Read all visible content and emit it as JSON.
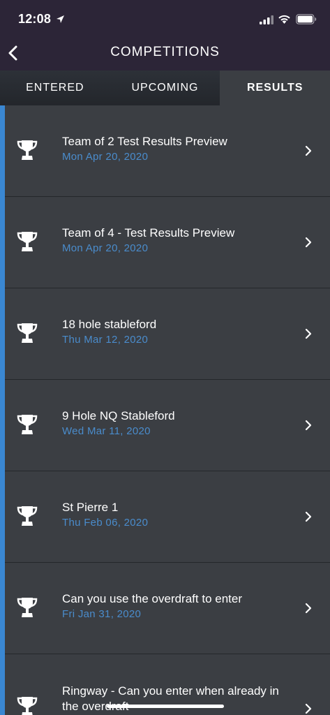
{
  "status_bar": {
    "time": "12:08"
  },
  "nav": {
    "title": "COMPETITIONS"
  },
  "tabs": [
    {
      "label": "ENTERED",
      "active": false
    },
    {
      "label": "UPCOMING",
      "active": false
    },
    {
      "label": "RESULTS",
      "active": true
    }
  ],
  "results": [
    {
      "title": "Team of 2 Test Results Preview",
      "date": "Mon Apr 20, 2020"
    },
    {
      "title": "Team of 4 - Test Results Preview",
      "date": "Mon Apr 20, 2020"
    },
    {
      "title": "18 hole stableford",
      "date": "Thu Mar 12, 2020"
    },
    {
      "title": "9 Hole NQ Stableford",
      "date": "Wed Mar 11, 2020"
    },
    {
      "title": "St Pierre 1",
      "date": "Thu Feb 06, 2020"
    },
    {
      "title": "Can you use the overdraft to enter",
      "date": "Fri Jan 31, 2020"
    },
    {
      "title": "Ringway - Can you enter when already in the overdraft",
      "date": ""
    }
  ],
  "colors": {
    "header_bg": "#2c2537",
    "list_bg": "#3b3e43",
    "accent": "#3a87d2",
    "date_text": "#4a8ccc"
  },
  "icons": {
    "row": "trophy-icon",
    "row_action": "chevron-right-icon",
    "back": "chevron-left-icon"
  }
}
